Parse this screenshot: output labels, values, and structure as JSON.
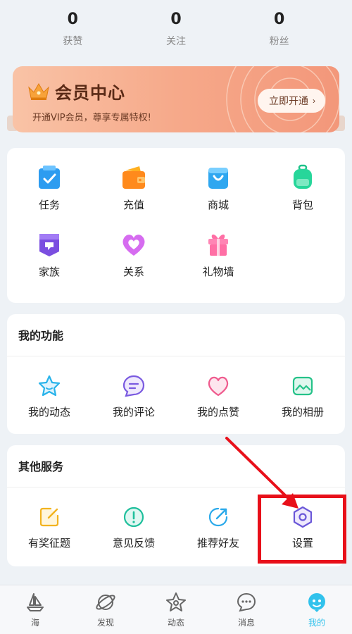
{
  "stats": [
    {
      "value": "0",
      "label": "获赞"
    },
    {
      "value": "0",
      "label": "关注"
    },
    {
      "value": "0",
      "label": "粉丝"
    }
  ],
  "vip": {
    "title": "会员中心",
    "subtitle": "开通VIP会员，尊享专属特权!",
    "button_label": "立即开通",
    "button_chevron": "›"
  },
  "grid": [
    {
      "label": "任务",
      "icon": "task-icon"
    },
    {
      "label": "充值",
      "icon": "wallet-icon"
    },
    {
      "label": "商城",
      "icon": "shop-bag-icon"
    },
    {
      "label": "背包",
      "icon": "backpack-icon"
    },
    {
      "label": "家族",
      "icon": "family-flag-icon"
    },
    {
      "label": "关系",
      "icon": "heart-icon"
    },
    {
      "label": "礼物墙",
      "icon": "gift-icon"
    }
  ],
  "my_functions": {
    "title": "我的功能",
    "items": [
      {
        "label": "我的动态",
        "icon": "star-icon"
      },
      {
        "label": "我的评论",
        "icon": "comment-icon"
      },
      {
        "label": "我的点赞",
        "icon": "heart-outline-icon"
      },
      {
        "label": "我的相册",
        "icon": "album-icon"
      }
    ]
  },
  "other_services": {
    "title": "其他服务",
    "items": [
      {
        "label": "有奖征题",
        "icon": "edit-icon"
      },
      {
        "label": "意见反馈",
        "icon": "exclamation-icon"
      },
      {
        "label": "推荐好友",
        "icon": "share-icon"
      },
      {
        "label": "设置",
        "icon": "settings-hexagon-icon"
      }
    ]
  },
  "tabs": [
    {
      "label": "海",
      "icon": "sailboat-icon"
    },
    {
      "label": "发现",
      "icon": "planet-icon"
    },
    {
      "label": "动态",
      "icon": "star-outline-icon"
    },
    {
      "label": "消息",
      "icon": "chat-icon"
    },
    {
      "label": "我的",
      "icon": "profile-face-icon",
      "active": true
    }
  ],
  "colors": {
    "accent": "#31c2ec",
    "annotation": "#e8101a",
    "vip_gradient_start": "#f9c3a6",
    "vip_gradient_end": "#f3977a"
  }
}
